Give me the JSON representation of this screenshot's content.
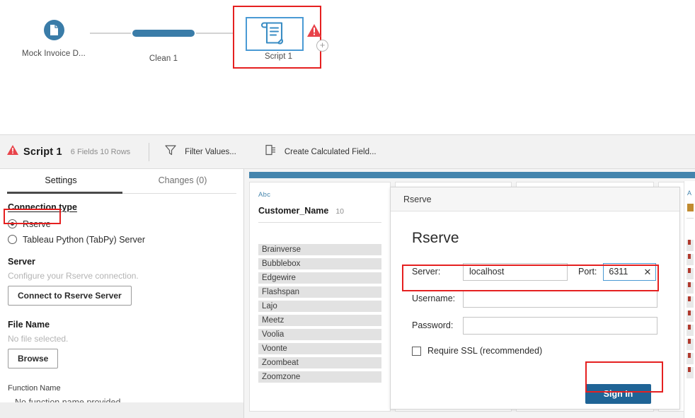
{
  "flow": {
    "nodes": [
      {
        "id": "input",
        "label": "Mock Invoice D...",
        "icon": "file-icon"
      },
      {
        "id": "clean",
        "label": "Clean 1",
        "icon": "clean-step-bar"
      },
      {
        "id": "script",
        "label": "Script 1",
        "icon": "script-scroll-icon",
        "warning": true,
        "selected": true
      }
    ],
    "add_button_label": "+"
  },
  "toolbar": {
    "title": "Script 1",
    "meta": "6 Fields  10 Rows",
    "warning_icon": "warning-triangle-icon",
    "actions": [
      {
        "label": "Filter Values...",
        "icon": "filter-funnel-icon"
      },
      {
        "label": "Create Calculated Field...",
        "icon": "calculated-field-icon"
      }
    ]
  },
  "settings": {
    "tabs": [
      {
        "label": "Settings",
        "active": true
      },
      {
        "label": "Changes (0)",
        "active": false
      }
    ],
    "connection_type": {
      "title": "Connection type",
      "options": [
        {
          "label": "Rserve",
          "selected": true,
          "highlighted": true
        },
        {
          "label": "Tableau Python (TabPy) Server",
          "selected": false,
          "highlighted": false
        }
      ]
    },
    "server": {
      "title": "Server",
      "note": "Configure your Rserve connection.",
      "button": "Connect to Rserve Server"
    },
    "file_name": {
      "title": "File Name",
      "note": "No file selected.",
      "button": "Browse"
    },
    "function_name": {
      "title": "Function Name",
      "value": "No function name provided."
    }
  },
  "profile": {
    "columns": [
      {
        "type": "Abc",
        "name": "Customer_Name",
        "count": "10",
        "values": [
          "Brainverse",
          "Bubblebox",
          "Edgewire",
          "Flashspan",
          "Lajo",
          "Meetz",
          "Voolia",
          "Voonte",
          "Zoombeat",
          "Zoomzone"
        ]
      }
    ]
  },
  "dialog": {
    "titlebar": "Rserve",
    "heading": "Rserve",
    "fields": {
      "server_label": "Server:",
      "server_value": "localhost",
      "server_placeholder": "",
      "port_label": "Port:",
      "port_value": "6311",
      "port_clear_icon": "✕",
      "username_label": "Username:",
      "username_value": "",
      "username_placeholder": "",
      "password_label": "Password:",
      "password_value": "",
      "password_placeholder": ""
    },
    "ssl": {
      "label": "Require SSL (recommended)",
      "checked": false
    },
    "submit": "Sign In"
  },
  "colors": {
    "accent_blue": "#4585ad",
    "node_blue": "#3a7ca8",
    "button_blue": "#1f6496",
    "highlight_red": "#e52020",
    "warning_red": "#e8434a",
    "focus_blue": "#4a9ad4"
  }
}
